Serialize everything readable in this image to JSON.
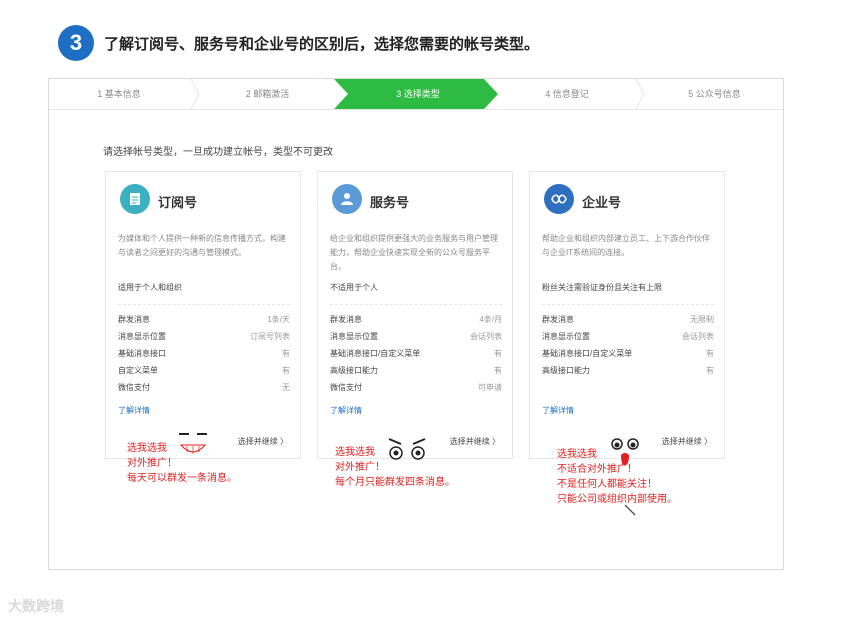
{
  "header": {
    "step_number": "3",
    "instruction": "了解订阅号、服务号和企业号的区别后，选择您需要的帐号类型。"
  },
  "steps": [
    {
      "label": "1 基本信息"
    },
    {
      "label": "2 邮箱激活"
    },
    {
      "label": "3 选择类型"
    },
    {
      "label": "4 信息登记"
    },
    {
      "label": "5 公众号信息"
    }
  ],
  "accent_color": "#2ebb44",
  "section_hint": "请选择帐号类型，一旦成功建立帐号，类型不可更改",
  "cards": [
    {
      "title": "订阅号",
      "icon": "document-icon",
      "icon_color": "#3ab0c0",
      "desc": "为媒体和个人提供一种新的信息传播方式，构建与读者之间更好的沟通与管理模式。",
      "scope": "适用于个人和组织",
      "features": [
        {
          "k": "群发消息",
          "v": "1条/天"
        },
        {
          "k": "消息显示位置",
          "v": "订阅号列表"
        },
        {
          "k": "基础消息接口",
          "v": "有"
        },
        {
          "k": "自定义菜单",
          "v": "有"
        },
        {
          "k": "微信支付",
          "v": "无"
        }
      ],
      "more": "了解详情",
      "choose": "选择并继续 〉"
    },
    {
      "title": "服务号",
      "icon": "user-service-icon",
      "icon_color": "#5a9ad6",
      "desc": "给企业和组织提供更强大的业务服务与用户管理能力，帮助企业快速实现全新的公众号服务平台。",
      "scope": "不适用于个人",
      "features": [
        {
          "k": "群发消息",
          "v": "4条/月"
        },
        {
          "k": "消息显示位置",
          "v": "会话列表"
        },
        {
          "k": "基础消息接口/自定义菜单",
          "v": "有"
        },
        {
          "k": "高级接口能力",
          "v": "有"
        },
        {
          "k": "微信支付",
          "v": "可申请"
        }
      ],
      "more": "了解详情",
      "choose": "选择并继续 〉"
    },
    {
      "title": "企业号",
      "icon": "enterprise-icon",
      "icon_color": "#2f6fc0",
      "desc": "帮助企业和组织内部建立员工、上下游合作伙伴与企业IT系统间的连接。",
      "scope": "粉丝关注需验证身份且关注有上限",
      "features": [
        {
          "k": "群发消息",
          "v": "无限制"
        },
        {
          "k": "消息显示位置",
          "v": "会话列表"
        },
        {
          "k": "基础消息接口/自定义菜单",
          "v": "有"
        },
        {
          "k": "高级接口能力",
          "v": "有"
        }
      ],
      "more": "了解详情",
      "choose": "选择并继续 〉"
    }
  ],
  "notes": [
    {
      "lines": [
        "选我选我",
        "对外推广！",
        "每天可以群发一条消息。"
      ]
    },
    {
      "lines": [
        "选我选我",
        "对外推广！",
        "每个月只能群发四条消息。"
      ]
    },
    {
      "lines": [
        "选我选我",
        "不适合对外推广！",
        "不是任何人都能关注！",
        "只能公司或组织内部使用。"
      ]
    }
  ],
  "watermark": "大数跨境"
}
